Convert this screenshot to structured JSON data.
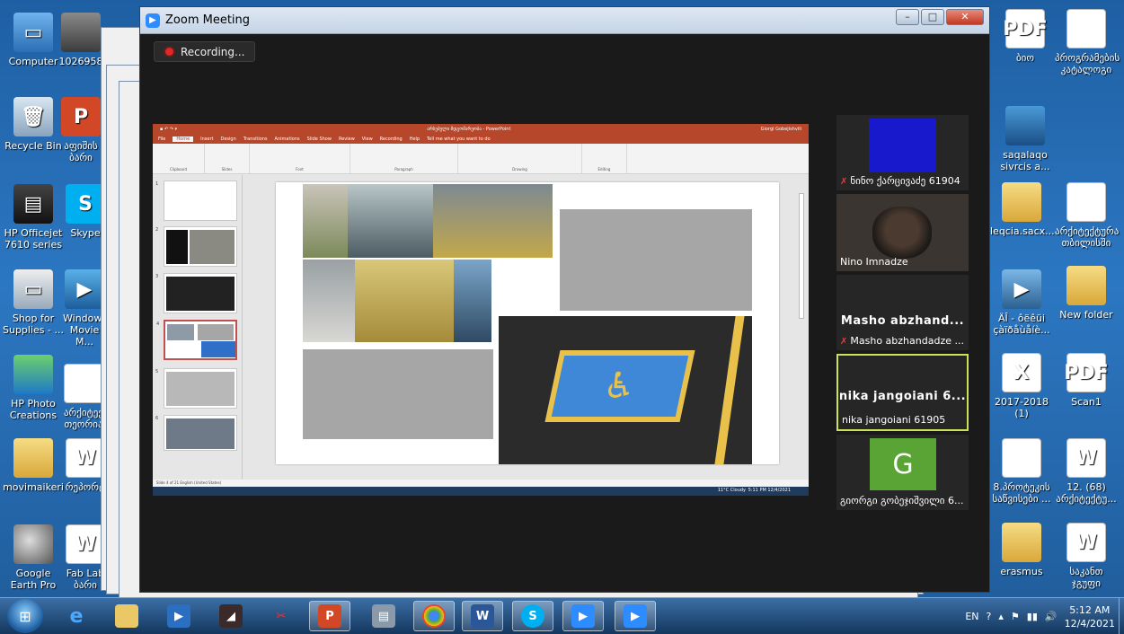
{
  "desktop_left": [
    {
      "label": "Computer",
      "icon": "computer-icon"
    },
    {
      "label": "1026958",
      "icon": "photo-icon"
    },
    {
      "label": "Recycle Bin",
      "icon": "recycle-bin-icon"
    },
    {
      "label": "აფიშის ბარი",
      "icon": "powerpoint-file-icon"
    },
    {
      "label": "HP Officejet 7610 series",
      "icon": "printer-icon"
    },
    {
      "label": "Skype",
      "icon": "skype-icon"
    },
    {
      "label": "Shop for Supplies - ...",
      "icon": "shop-icon"
    },
    {
      "label": "Windows Movie M...",
      "icon": "movie-maker-icon"
    },
    {
      "label": "HP Photo Creations",
      "icon": "hp-photo-icon"
    },
    {
      "label": "არქიტექ თეორია",
      "icon": "document-icon"
    },
    {
      "label": "movimaikeri",
      "icon": "folder-icon"
    },
    {
      "label": "რეპორტ",
      "icon": "word-file-icon"
    },
    {
      "label": "Google Earth Pro",
      "icon": "google-earth-icon"
    },
    {
      "label": "Fab Lab ბარი",
      "icon": "word-file-icon"
    }
  ],
  "desktop_right": [
    {
      "label": "ბიო",
      "icon": "pdf-icon"
    },
    {
      "label": "პროგრამების კატალოგი",
      "icon": "document-icon"
    },
    {
      "label": "saqalaqo sivrcis a...",
      "icon": "laptop-ppt-icon"
    },
    {
      "label": "leqcia.sacx...",
      "icon": "folder-icon"
    },
    {
      "label": "არქიტექტურა თბილისში",
      "icon": "document-icon"
    },
    {
      "label": "ÄÎ - ôëêüi çàïðåùåíè...",
      "icon": "video-file-icon"
    },
    {
      "label": "New folder",
      "icon": "folder-icon"
    },
    {
      "label": "2017-2018 (1)",
      "icon": "excel-file-icon"
    },
    {
      "label": "Scan1",
      "icon": "pdf-icon"
    },
    {
      "label": "8.პროტეკის საწვისები ...",
      "icon": "ppt-file-icon"
    },
    {
      "label": "12. (68) არქიტექტუ...",
      "icon": "word-file-icon"
    },
    {
      "label": "erasmus",
      "icon": "folder-icon"
    },
    {
      "label": "საკანთ ჯგუფი",
      "icon": "word-file-icon"
    }
  ],
  "zoom": {
    "title": "Zoom Meeting",
    "recording_label": "Recording...",
    "window_buttons": {
      "minimize": "–",
      "maximize": "□",
      "close": "✕"
    }
  },
  "ppt": {
    "title": "არსებული მდგომარეობა - PowerPoint",
    "user": "Giorgi Gobejishvili",
    "tabs": [
      "File",
      "Home",
      "Insert",
      "Design",
      "Transitions",
      "Animations",
      "Slide Show",
      "Review",
      "View",
      "Recording",
      "Help",
      "Tell me what you want to do"
    ],
    "groups": [
      "Clipboard",
      "Slides",
      "Font",
      "Paragraph",
      "Drawing",
      "Editing"
    ],
    "status": "Slide 4 of 21   English (United States)",
    "slide_numbers": [
      "1",
      "2",
      "3",
      "4",
      "5",
      "6"
    ],
    "weather": "11°C Cloudy",
    "clock": "5:11 PM 12/4/2021"
  },
  "participants": [
    {
      "name": "ნინო ქარცივაძე 61904",
      "video": "blue",
      "muted": true
    },
    {
      "name": "Nino Imnadze",
      "video": "webcam",
      "muted": false
    },
    {
      "name": "Masho abzhandadze ...",
      "big_name": "Masho abzhand...",
      "muted": true
    },
    {
      "name": "nika jangoiani 61905",
      "big_name": "nika jangoiani 6...",
      "active_speaker": true,
      "muted": false
    },
    {
      "name": "გიორგი გობეჯიშვილი 6...",
      "initial": "G",
      "muted": false
    }
  ],
  "taskbar": {
    "language": "EN",
    "time": "5:12 AM",
    "date": "12/4/2021",
    "apps": [
      "internet-explorer-icon",
      "file-explorer-icon",
      "media-center-icon",
      "archicad-icon",
      "paint-icon",
      "powerpoint-icon",
      "scanner-icon",
      "chrome-icon",
      "word-icon",
      "skype-icon",
      "zoom-icon",
      "zoom-icon"
    ]
  },
  "colors": {
    "accent_ppt": "#b7472a",
    "zoom_blue": "#2d8cff",
    "active_speaker": "#c8e35a",
    "avatar_green": "#5aa335"
  }
}
